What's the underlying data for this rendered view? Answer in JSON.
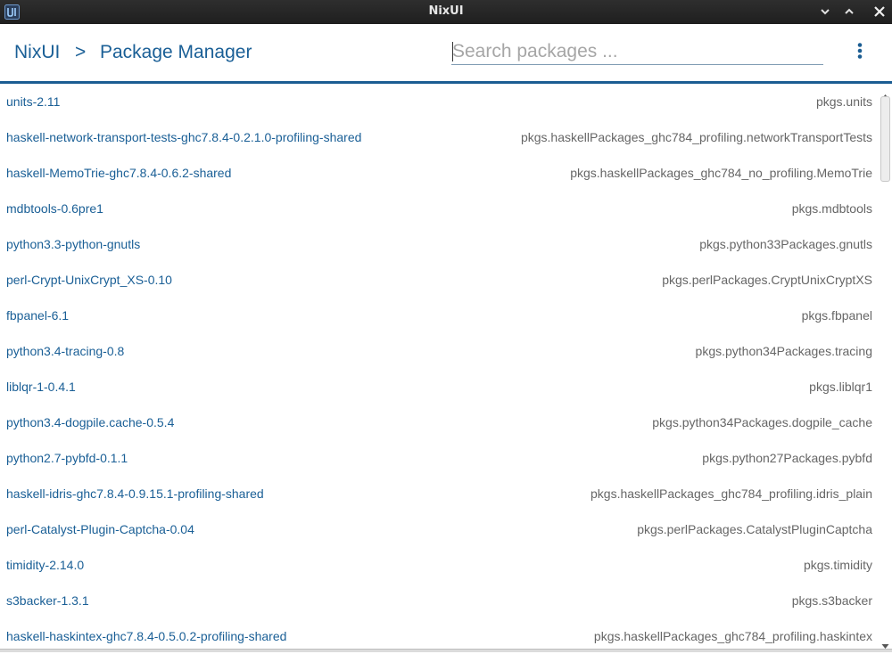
{
  "window": {
    "title": "NixUI",
    "app_icon": "nixui-logo-icon"
  },
  "header": {
    "breadcrumb_root": "NixUI",
    "breadcrumb_separator": ">",
    "breadcrumb_page": "Package Manager",
    "search_placeholder": "Search packages ...",
    "search_value": "",
    "menu_icon": "vertical-dots-icon"
  },
  "packages": [
    {
      "name": "units-2.11",
      "attr": "pkgs.units"
    },
    {
      "name": "haskell-network-transport-tests-ghc7.8.4-0.2.1.0-profiling-shared",
      "attr": "pkgs.haskellPackages_ghc784_profiling.networkTransportTests"
    },
    {
      "name": "haskell-MemoTrie-ghc7.8.4-0.6.2-shared",
      "attr": "pkgs.haskellPackages_ghc784_no_profiling.MemoTrie"
    },
    {
      "name": "mdbtools-0.6pre1",
      "attr": "pkgs.mdbtools"
    },
    {
      "name": "python3.3-python-gnutls",
      "attr": "pkgs.python33Packages.gnutls"
    },
    {
      "name": "perl-Crypt-UnixCrypt_XS-0.10",
      "attr": "pkgs.perlPackages.CryptUnixCryptXS"
    },
    {
      "name": "fbpanel-6.1",
      "attr": "pkgs.fbpanel"
    },
    {
      "name": "python3.4-tracing-0.8",
      "attr": "pkgs.python34Packages.tracing"
    },
    {
      "name": "liblqr-1-0.4.1",
      "attr": "pkgs.liblqr1"
    },
    {
      "name": "python3.4-dogpile.cache-0.5.4",
      "attr": "pkgs.python34Packages.dogpile_cache"
    },
    {
      "name": "python2.7-pybfd-0.1.1",
      "attr": "pkgs.python27Packages.pybfd"
    },
    {
      "name": "haskell-idris-ghc7.8.4-0.9.15.1-profiling-shared",
      "attr": "pkgs.haskellPackages_ghc784_profiling.idris_plain"
    },
    {
      "name": "perl-Catalyst-Plugin-Captcha-0.04",
      "attr": "pkgs.perlPackages.CatalystPluginCaptcha"
    },
    {
      "name": "timidity-2.14.0",
      "attr": "pkgs.timidity"
    },
    {
      "name": "s3backer-1.3.1",
      "attr": "pkgs.s3backer"
    },
    {
      "name": "haskell-haskintex-ghc7.8.4-0.5.0.2-profiling-shared",
      "attr": "pkgs.haskellPackages_ghc784_profiling.haskintex"
    }
  ],
  "scrollbar": {
    "position": 0.0
  },
  "colors": {
    "accent": "#1b5d92",
    "link": "#1a5f96",
    "muted": "#666666"
  }
}
